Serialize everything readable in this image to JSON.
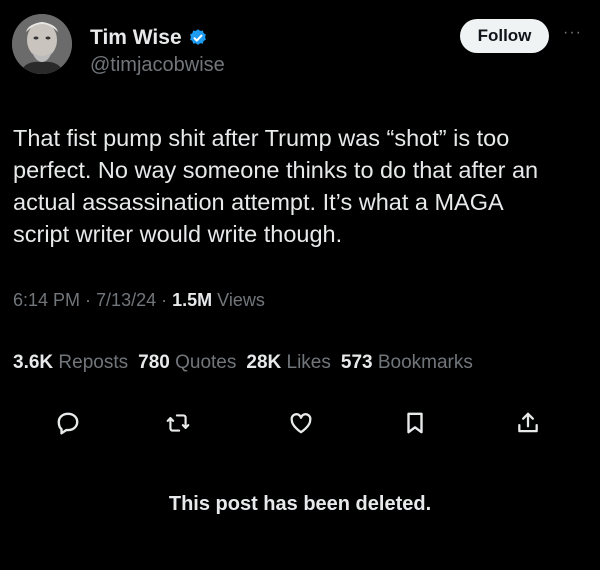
{
  "user": {
    "name": "Tim Wise",
    "handle": "@timjacobwise",
    "verified_color": "#1d9bf0"
  },
  "follow_label": "Follow",
  "more_label": "···",
  "tweet": {
    "text": "That fist pump shit after Trump was “shot” is too\nperfect. No way someone thinks to do that after an\nactual assassination attempt. It’s what a MAGA\nscript writer would write though.",
    "time": "6:14 PM",
    "date": "7/13/24",
    "views_count": "1.5M",
    "views_label": "Views"
  },
  "stats": [
    {
      "count": "3.6K",
      "label": "Reposts"
    },
    {
      "count": "780",
      "label": "Quotes"
    },
    {
      "count": "28K",
      "label": "Likes"
    },
    {
      "count": "573",
      "label": "Bookmarks"
    }
  ],
  "actions": [
    "reply-icon",
    "repost-icon",
    "like-icon",
    "bookmark-icon",
    "share-icon"
  ],
  "deleted_notice": "This post has been deleted."
}
